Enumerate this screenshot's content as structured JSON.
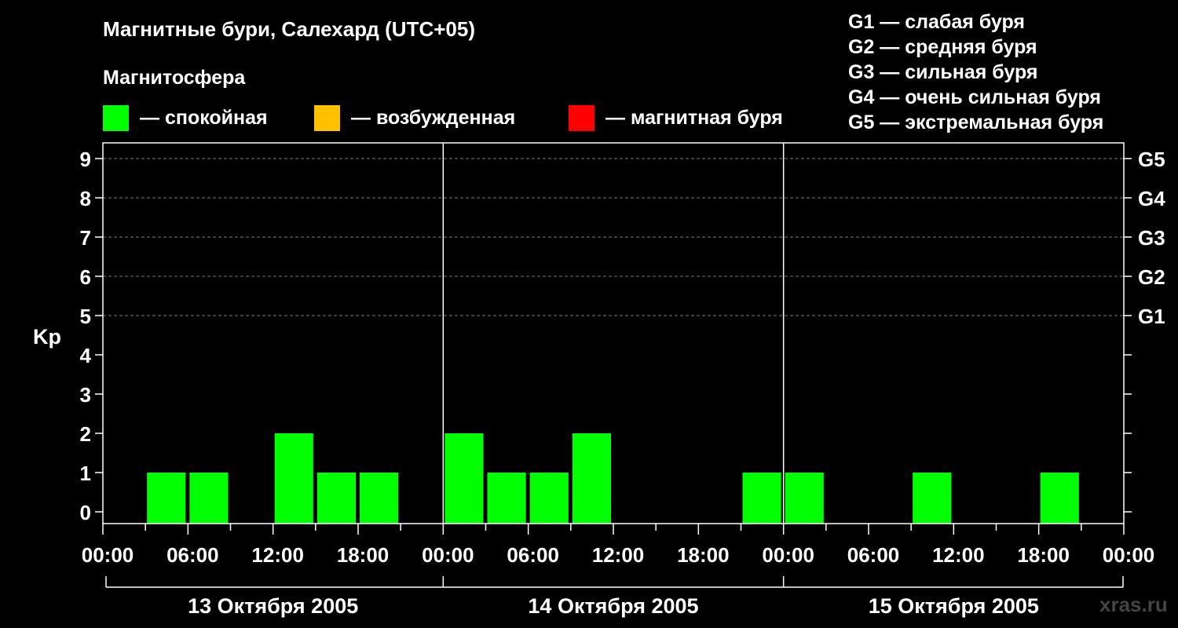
{
  "title": "Магнитные бури, Салехард (UTC+05)",
  "subtitle": "Магнитосфера",
  "legend": [
    {
      "label": "— спокойная",
      "color": "#00ff00"
    },
    {
      "label": "— возбужденная",
      "color": "#ffc000"
    },
    {
      "label": "— магнитная буря",
      "color": "#ff0000"
    }
  ],
  "g_legend": [
    "G1 — слабая буря",
    "G2 — средняя буря",
    "G3 — сильная буря",
    "G4 — очень сильная буря",
    "G5 — экстремальная буря"
  ],
  "watermark": "xras.ru",
  "chart_data": {
    "type": "bar",
    "ylabel": "Kp",
    "ylim": [
      0,
      9
    ],
    "y_ticks": [
      "0",
      "1",
      "2",
      "3",
      "4",
      "5",
      "6",
      "7",
      "8",
      "9"
    ],
    "right_ticks": [
      {
        "kp": 5,
        "label": "G1"
      },
      {
        "kp": 6,
        "label": "G2"
      },
      {
        "kp": 7,
        "label": "G3"
      },
      {
        "kp": 8,
        "label": "G4"
      },
      {
        "kp": 9,
        "label": "G5"
      }
    ],
    "x_tick_labels": [
      "00:00",
      "06:00",
      "12:00",
      "18:00",
      "00:00",
      "06:00",
      "12:00",
      "18:00",
      "00:00",
      "06:00",
      "12:00",
      "18:00",
      "00:00"
    ],
    "days": [
      "13 Октября 2005",
      "14 Октября 2005",
      "15 Октября 2005"
    ],
    "grid": "dashed horizontal at Kp 5–9",
    "series": [
      {
        "values": [
          0,
          1,
          1,
          0,
          2,
          1,
          1,
          0,
          2,
          1,
          1,
          2,
          0,
          0,
          0,
          1,
          1,
          0,
          0,
          1,
          0,
          0,
          1,
          0
        ]
      }
    ],
    "bar_colors": [
      "#00ff00",
      "#00ff00",
      "#00ff00",
      "#00ff00",
      "#00ff00",
      "#00ff00",
      "#00ff00",
      "#00ff00",
      "#00ff00",
      "#00ff00",
      "#00ff00",
      "#00ff00",
      "#00ff00",
      "#00ff00",
      "#00ff00",
      "#00ff00",
      "#00ff00",
      "#00ff00",
      "#00ff00",
      "#00ff00",
      "#00ff00",
      "#00ff00",
      "#00ff00",
      "#00ff00"
    ]
  }
}
